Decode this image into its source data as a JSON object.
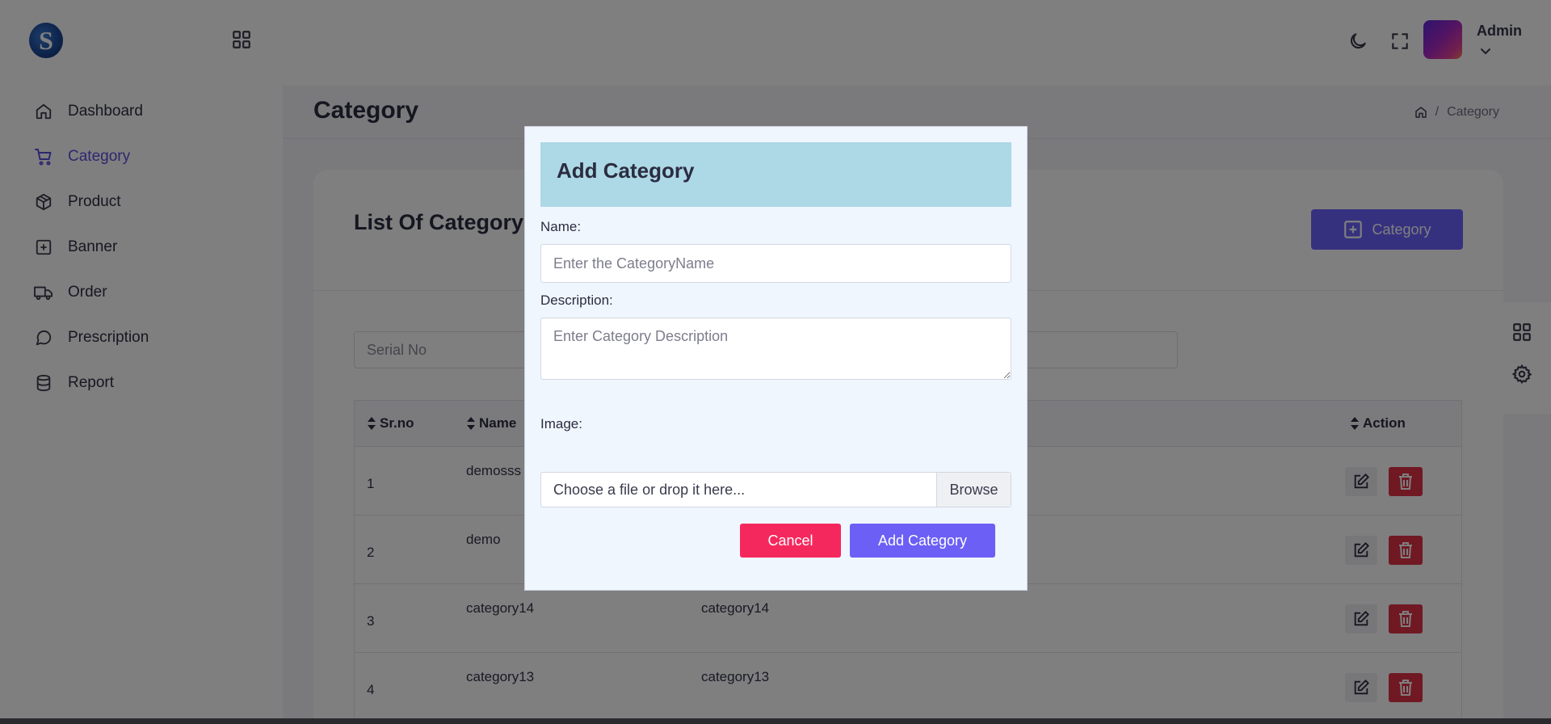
{
  "sidebar": {
    "logo_letter": "S",
    "items": [
      {
        "label": "Dashboard",
        "icon": "home-icon",
        "active": false
      },
      {
        "label": "Category",
        "icon": "cart-icon",
        "active": true
      },
      {
        "label": "Product",
        "icon": "box-icon",
        "active": false
      },
      {
        "label": "Banner",
        "icon": "plus-square-icon",
        "active": false
      },
      {
        "label": "Order",
        "icon": "truck-icon",
        "active": false
      },
      {
        "label": "Prescription",
        "icon": "chat-icon",
        "active": false
      },
      {
        "label": "Report",
        "icon": "database-icon",
        "active": false
      }
    ]
  },
  "topbar": {
    "user_name": "Admin"
  },
  "page": {
    "title": "Category",
    "breadcrumb_current": "Category"
  },
  "card": {
    "title": "List Of Category",
    "add_button_label": "Category",
    "search_placeholder": "Serial No"
  },
  "table": {
    "headers": {
      "sr": "Sr.no",
      "name": "Name",
      "action": "Action"
    },
    "rows": [
      {
        "sr": "1",
        "name": "demosss",
        "desc": ""
      },
      {
        "sr": "2",
        "name": "demo",
        "desc": ""
      },
      {
        "sr": "3",
        "name": "category14",
        "desc": "category14"
      },
      {
        "sr": "4",
        "name": "category13",
        "desc": "category13"
      }
    ]
  },
  "modal": {
    "title": "Add Category",
    "name_label": "Name:",
    "name_placeholder": "Enter the CategoryName",
    "description_label": "Description:",
    "description_placeholder": "Enter Category Description",
    "image_label": "Image:",
    "file_placeholder": "Choose a file or drop it here...",
    "browse_label": "Browse",
    "cancel_label": "Cancel",
    "submit_label": "Add Category"
  },
  "colors": {
    "accent": "#6c63ff",
    "active_nav": "#5a4fe0",
    "danger": "#e03247",
    "cancel": "#f5285e",
    "modal_header": "#add8e6"
  }
}
